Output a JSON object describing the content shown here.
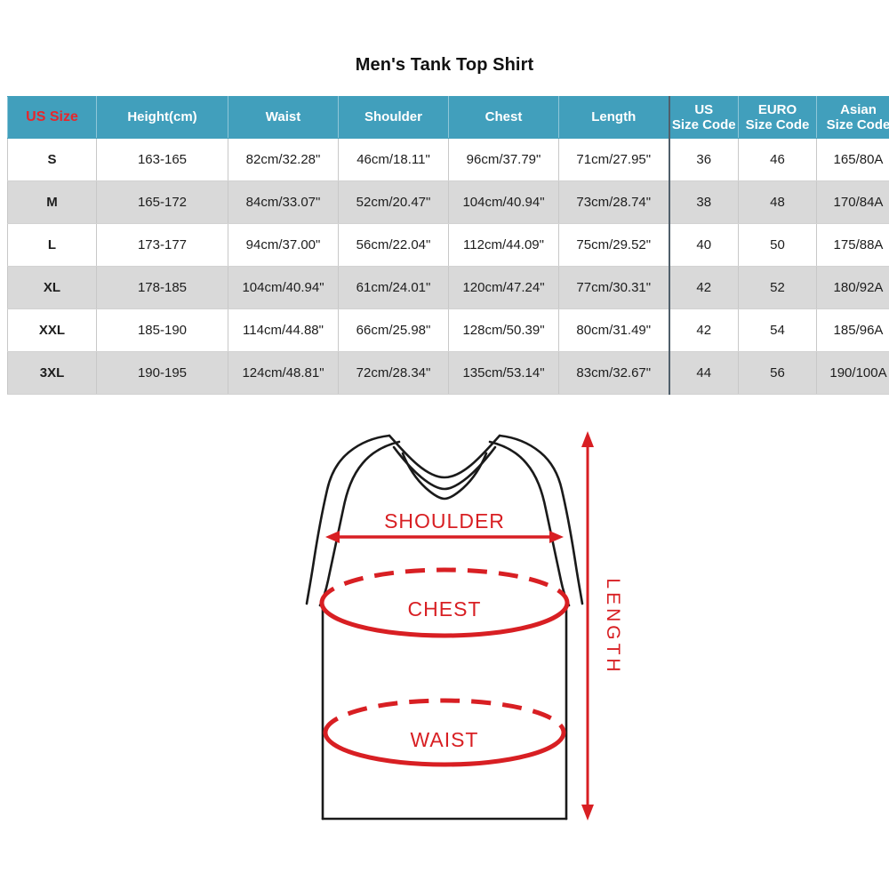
{
  "page": {
    "title": "Men's Tank Top Shirt",
    "background_color": "#ffffff"
  },
  "colors": {
    "header_bg": "#419FBC",
    "header_text": "#ffffff",
    "us_size_header_text": "#E8262B",
    "row_odd_bg": "#ffffff",
    "row_even_bg": "#d9d9d9",
    "divider": "#505f6b",
    "annotation_red": "#D81F23",
    "garment_outline": "#1a1a1a"
  },
  "table": {
    "headers": [
      {
        "label": "US Size",
        "lines": [
          "US Size"
        ]
      },
      {
        "label": "Height(cm)",
        "lines": [
          "Height(cm)"
        ]
      },
      {
        "label": "Waist",
        "lines": [
          "Waist"
        ]
      },
      {
        "label": "Shoulder",
        "lines": [
          "Shoulder"
        ]
      },
      {
        "label": "Chest",
        "lines": [
          "Chest"
        ]
      },
      {
        "label": "Length",
        "lines": [
          "Length"
        ]
      },
      {
        "label": "US Size Code",
        "lines": [
          "US",
          "Size Code"
        ]
      },
      {
        "label": "EURO Size Code",
        "lines": [
          "EURO",
          "Size Code"
        ]
      },
      {
        "label": "Asian Size Code",
        "lines": [
          "Asian",
          "Size Code"
        ]
      }
    ],
    "rows": [
      {
        "us_size": "S",
        "height": "163-165",
        "waist": "82cm/32.28\"",
        "shoulder": "46cm/18.11\"",
        "chest": "96cm/37.79\"",
        "length": "71cm/27.95\"",
        "us_size_code": "36",
        "euro_size_code": "46",
        "asian_size_code": "165/80A"
      },
      {
        "us_size": "M",
        "height": "165-172",
        "waist": "84cm/33.07\"",
        "shoulder": "52cm/20.47\"",
        "chest": "104cm/40.94\"",
        "length": "73cm/28.74\"",
        "us_size_code": "38",
        "euro_size_code": "48",
        "asian_size_code": "170/84A"
      },
      {
        "us_size": "L",
        "height": "173-177",
        "waist": "94cm/37.00\"",
        "shoulder": "56cm/22.04\"",
        "chest": "112cm/44.09\"",
        "length": "75cm/29.52\"",
        "us_size_code": "40",
        "euro_size_code": "50",
        "asian_size_code": "175/88A"
      },
      {
        "us_size": "XL",
        "height": "178-185",
        "waist": "104cm/40.94\"",
        "shoulder": "61cm/24.01\"",
        "chest": "120cm/47.24\"",
        "length": "77cm/30.31\"",
        "us_size_code": "42",
        "euro_size_code": "52",
        "asian_size_code": "180/92A"
      },
      {
        "us_size": "XXL",
        "height": "185-190",
        "waist": "114cm/44.88\"",
        "shoulder": "66cm/25.98\"",
        "chest": "128cm/50.39\"",
        "length": "80cm/31.49\"",
        "us_size_code": "42",
        "euro_size_code": "54",
        "asian_size_code": "185/96A"
      },
      {
        "us_size": "3XL",
        "height": "190-195",
        "waist": "124cm/48.81\"",
        "shoulder": "72cm/28.34\"",
        "chest": "135cm/53.14\"",
        "length": "83cm/32.67\"",
        "us_size_code": "44",
        "euro_size_code": "56",
        "asian_size_code": "190/100A"
      }
    ]
  },
  "diagram": {
    "garment": "mens-tank-top",
    "labels": {
      "shoulder": "SHOULDER",
      "chest": "CHEST",
      "waist": "WAIST",
      "length": "LENGTH"
    }
  }
}
